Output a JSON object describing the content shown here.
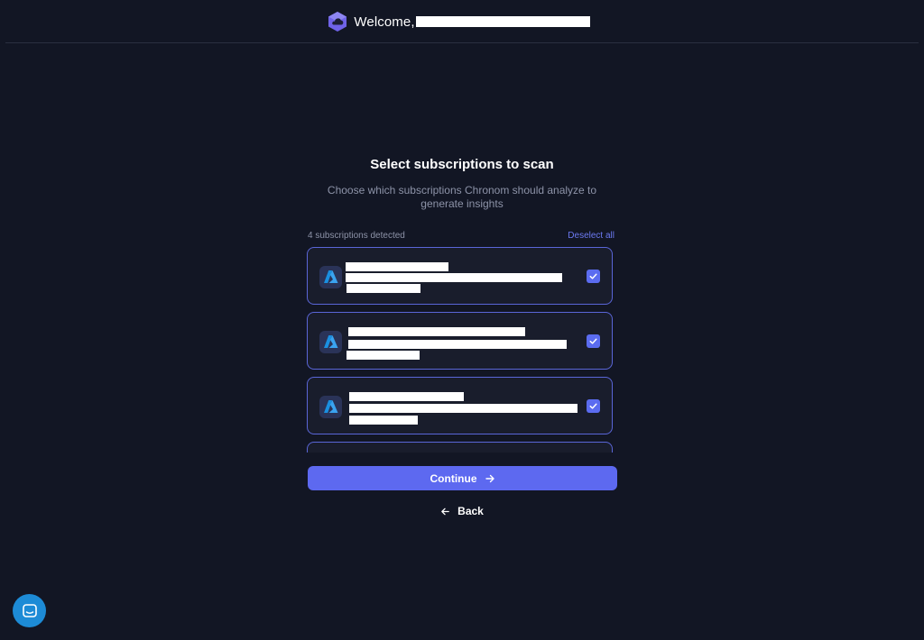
{
  "header": {
    "welcome_text": "Welcome,",
    "logo_icon": "chronom-cloud-hex-logo"
  },
  "main": {
    "title": "Select subscriptions to scan",
    "subtitle": "Choose which subscriptions Chronom should analyze to generate insights",
    "count_text": "4 subscriptions detected",
    "deselect_label": "Deselect all"
  },
  "subscriptions": [
    {
      "provider_icon": "azure-icon",
      "checked": true
    },
    {
      "provider_icon": "azure-icon",
      "checked": true
    },
    {
      "provider_icon": "azure-icon",
      "checked": true
    },
    {
      "provider_icon": "azure-icon",
      "checked": true
    }
  ],
  "actions": {
    "continue_label": "Continue",
    "back_label": "Back"
  },
  "colors": {
    "background": "#121624",
    "accent": "#5d69f0",
    "card_border": "#5a66d8",
    "chat_bubble": "#1d8bd6"
  }
}
